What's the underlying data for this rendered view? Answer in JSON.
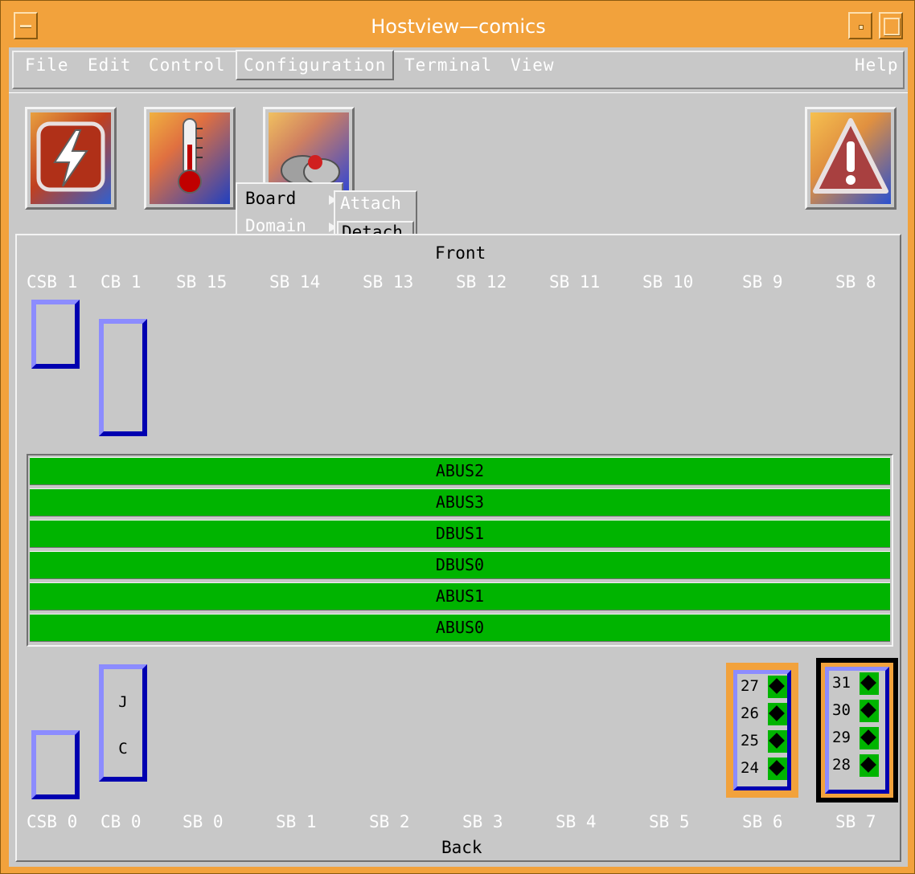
{
  "window": {
    "title": "Hostview—comics"
  },
  "menubar": {
    "items": [
      {
        "label": "File"
      },
      {
        "label": "Edit"
      },
      {
        "label": "Control"
      },
      {
        "label": "Configuration"
      },
      {
        "label": "Terminal"
      },
      {
        "label": "View"
      }
    ],
    "help": "Help"
  },
  "config_menu": {
    "items": [
      {
        "label": "Board"
      },
      {
        "label": "Domain"
      }
    ],
    "board_submenu": [
      {
        "label": "Attach"
      },
      {
        "label": "Detach"
      }
    ]
  },
  "toolbar": {
    "buttons": [
      {
        "icon": "power-icon"
      },
      {
        "icon": "thermometer-icon"
      },
      {
        "icon": "diagnostics-icon"
      },
      {
        "icon": "alert-icon"
      }
    ]
  },
  "cabinet": {
    "front_label": "Front",
    "back_label": "Back",
    "front_slots": [
      "CSB 1",
      "CB 1",
      "SB 15",
      "SB 14",
      "SB 13",
      "SB 12",
      "SB 11",
      "SB 10",
      "SB 9",
      "SB 8"
    ],
    "back_slots": [
      "CSB 0",
      "CB 0",
      "SB 0",
      "SB 1",
      "SB 2",
      "SB 3",
      "SB 4",
      "SB 5",
      "SB 6",
      "SB 7"
    ],
    "buses": [
      "ABUS2",
      "ABUS3",
      "DBUS1",
      "DBUS0",
      "ABUS1",
      "ABUS0"
    ],
    "cb0_letters": [
      "J",
      "C"
    ],
    "sb6_processors": [
      "27",
      "26",
      "25",
      "24"
    ],
    "sb7_processors": [
      "31",
      "30",
      "29",
      "28"
    ],
    "colors": {
      "bus": "#00b400",
      "board_border": "#f2a23c",
      "selected_border": "#000000",
      "slot_blue": "#0000b0"
    }
  }
}
